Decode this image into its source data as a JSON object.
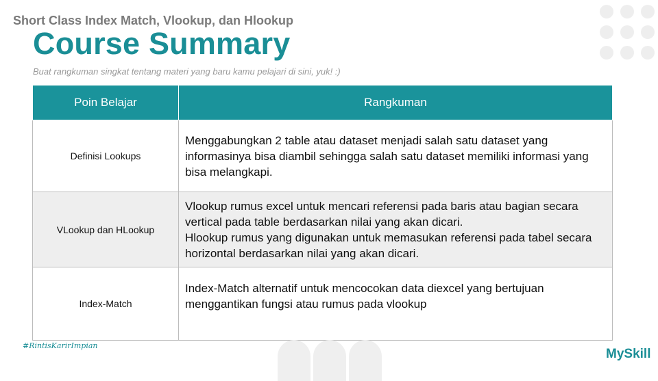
{
  "header": {
    "course_name": "Short Class Index Match, Vlookup, dan Hlookup",
    "title": "Course Summary",
    "instruction": "Buat rangkuman singkat tentang materi yang baru kamu pelajari di sini, yuk! :)"
  },
  "table": {
    "headers": {
      "point": "Poin Belajar",
      "summary": "Rangkuman"
    },
    "rows": [
      {
        "point": "Definisi Lookups",
        "summary": "Menggabungkan 2 table atau dataset menjadi salah satu dataset yang informasinya bisa diambil sehingga salah satu dataset memiliki informasi yang bisa melangkapi."
      },
      {
        "point": "VLookup dan HLookup",
        "summary": "Vlookup rumus excel untuk mencari referensi pada baris atau bagian secara vertical pada table berdasarkan nilai yang akan dicari.\nHlookup rumus yang digunakan untuk memasukan referensi pada tabel secara horizontal berdasarkan nilai yang akan dicari."
      },
      {
        "point": "Index-Match",
        "summary": "Index-Match alternatif untuk mencocokan data diexcel yang bertujuan menggantikan fungsi atau rumus pada vlookup"
      }
    ]
  },
  "footer": {
    "hashtag": "#RintisKarirImpian",
    "brand": "MySkill"
  },
  "colors": {
    "brand_teal": "#1a8e96",
    "header_teal": "#1a939b",
    "row_alt_gray": "#eeeeee"
  }
}
